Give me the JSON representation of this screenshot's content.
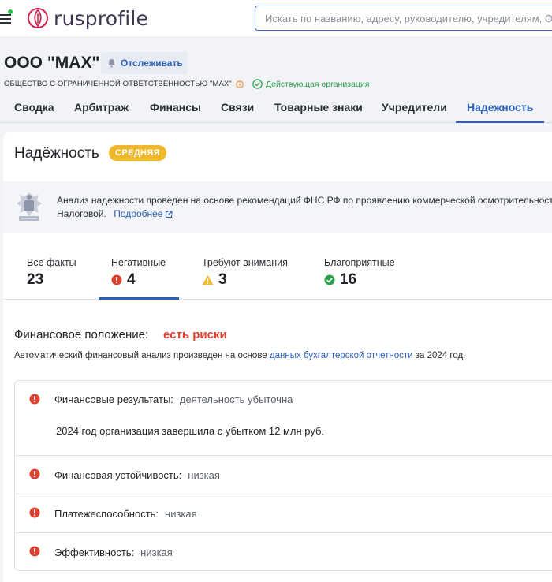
{
  "header": {
    "logo_text": "rusprofile",
    "search_placeholder": "Искать по названию, адресу, руководителю, учредителям, ОГРН"
  },
  "company": {
    "name": "ООО \"МАХ\"",
    "follow_label": "Отслеживать",
    "legal_name": "ОБЩЕСТВО С ОГРАНИЧЕННОЙ ОТВЕТСТВЕННОСТЬЮ \"МАХ\"",
    "status": "Действующая организация"
  },
  "tabs": [
    {
      "label": "Сводка"
    },
    {
      "label": "Арбитраж"
    },
    {
      "label": "Финансы"
    },
    {
      "label": "Связи"
    },
    {
      "label": "Товарные знаки"
    },
    {
      "label": "Учредители"
    },
    {
      "label": "Надежность"
    }
  ],
  "reliability": {
    "title": "Надёжность",
    "level": "СРЕДНЯЯ",
    "notice_line1": "Анализ надежности проведен на основе рекомендаций ФНС РФ по проявлению коммерческой осмотрительности",
    "notice_line2": "Налоговой.",
    "notice_link": "Подробнее"
  },
  "filters": [
    {
      "label": "Все факты",
      "count": "23"
    },
    {
      "label": "Негативные",
      "count": "4"
    },
    {
      "label": "Требуют внимания",
      "count": "3"
    },
    {
      "label": "Благоприятные",
      "count": "16"
    }
  ],
  "financial": {
    "title": "Финансовое положение:",
    "risk": "есть риски",
    "desc_before": "Автоматический финансовый анализ произведен на основе",
    "desc_link": "данных бухгалтерской отчетности",
    "desc_after": "за 2024 год.",
    "items": [
      {
        "label": "Финансовые результаты:",
        "value": "деятельность убыточна",
        "detail": "2024 год организация завершила с убытком 12 млн руб."
      },
      {
        "label": "Финансовая устойчивость:",
        "value": "низкая"
      },
      {
        "label": "Платежеспособность:",
        "value": "низкая"
      },
      {
        "label": "Эффективность:",
        "value": "низкая"
      }
    ]
  },
  "colors": {
    "accent": "#2c5fb7",
    "negative": "#e0402f",
    "warning": "#f2b82c",
    "positive": "#2aa04b"
  }
}
